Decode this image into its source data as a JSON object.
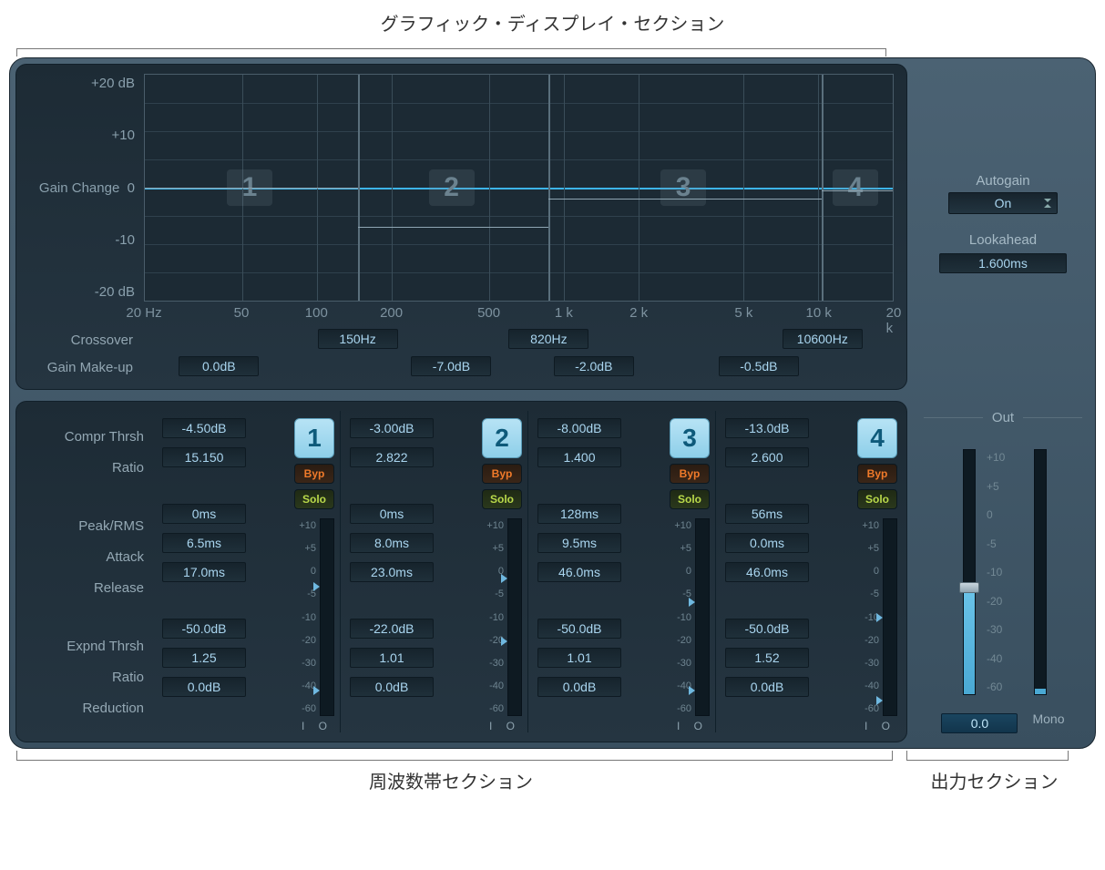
{
  "annotations": {
    "top": "グラフィック・ディスプレイ・セクション",
    "bottom_left": "周波数帯セクション",
    "bottom_right": "出力セクション"
  },
  "graph": {
    "y_axis_label": "Gain Change",
    "y_ticks": [
      "+20 dB",
      "+10",
      "0",
      "-10",
      "-20 dB"
    ],
    "x_ticks": [
      {
        "label": "20 Hz",
        "pct": 0
      },
      {
        "label": "50",
        "pct": 13
      },
      {
        "label": "100",
        "pct": 23
      },
      {
        "label": "200",
        "pct": 33
      },
      {
        "label": "500",
        "pct": 46
      },
      {
        "label": "1 k",
        "pct": 56
      },
      {
        "label": "2 k",
        "pct": 66
      },
      {
        "label": "5 k",
        "pct": 80
      },
      {
        "label": "10 k",
        "pct": 90
      },
      {
        "label": "20 k",
        "pct": 100
      }
    ],
    "crossover_label": "Crossover",
    "gain_makeup_label": "Gain Make-up",
    "crossover": [
      "150Hz",
      "820Hz",
      "10600Hz"
    ],
    "gain_makeup": [
      "0.0dB",
      "-7.0dB",
      "-2.0dB",
      "-0.5dB"
    ],
    "band_dividers_pct": [
      28.5,
      54,
      90.5
    ]
  },
  "side": {
    "autogain_label": "Autogain",
    "autogain_value": "On",
    "lookahead_label": "Lookahead",
    "lookahead_value": "1.600ms"
  },
  "band_param_labels": {
    "compr_thrsh": "Compr Thrsh",
    "ratio": "Ratio",
    "peak_rms": "Peak/RMS",
    "attack": "Attack",
    "release": "Release",
    "expnd_thrsh": "Expnd Thrsh",
    "ratio2": "Ratio",
    "reduction": "Reduction"
  },
  "buttons": {
    "byp": "Byp",
    "solo": "Solo"
  },
  "meter_ticks": [
    "+10",
    "+5",
    "0",
    "-5",
    "-10",
    "-20",
    "-30",
    "-40",
    "-60"
  ],
  "io_label": "I O",
  "bands": [
    {
      "num": "1",
      "compr_thrsh": "-4.50dB",
      "ratio": "15.150",
      "peak_rms": "0ms",
      "attack": "6.5ms",
      "release": "17.0ms",
      "expnd_thrsh": "-50.0dB",
      "ratio2": "1.25",
      "reduction": "0.0dB",
      "marks": [
        32,
        85
      ]
    },
    {
      "num": "2",
      "compr_thrsh": "-3.00dB",
      "ratio": "2.822",
      "peak_rms": "0ms",
      "attack": "8.0ms",
      "release": "23.0ms",
      "expnd_thrsh": "-22.0dB",
      "ratio2": "1.01",
      "reduction": "0.0dB",
      "marks": [
        28,
        60
      ]
    },
    {
      "num": "3",
      "compr_thrsh": "-8.00dB",
      "ratio": "1.400",
      "peak_rms": "128ms",
      "attack": "9.5ms",
      "release": "46.0ms",
      "expnd_thrsh": "-50.0dB",
      "ratio2": "1.01",
      "reduction": "0.0dB",
      "marks": [
        40,
        85
      ]
    },
    {
      "num": "4",
      "compr_thrsh": "-13.0dB",
      "ratio": "2.600",
      "peak_rms": "56ms",
      "attack": "0.0ms",
      "release": "46.0ms",
      "expnd_thrsh": "-50.0dB",
      "ratio2": "1.52",
      "reduction": "0.0dB",
      "marks": [
        48,
        90
      ]
    }
  ],
  "out": {
    "label": "Out",
    "value": "0.0",
    "mono": "Mono",
    "scale": [
      "+10",
      "+5",
      "0",
      "-5",
      "-10",
      "-20",
      "-30",
      "-40",
      "-60"
    ],
    "slider_fill_pct": 46,
    "slider_thumb_pct": 54
  }
}
